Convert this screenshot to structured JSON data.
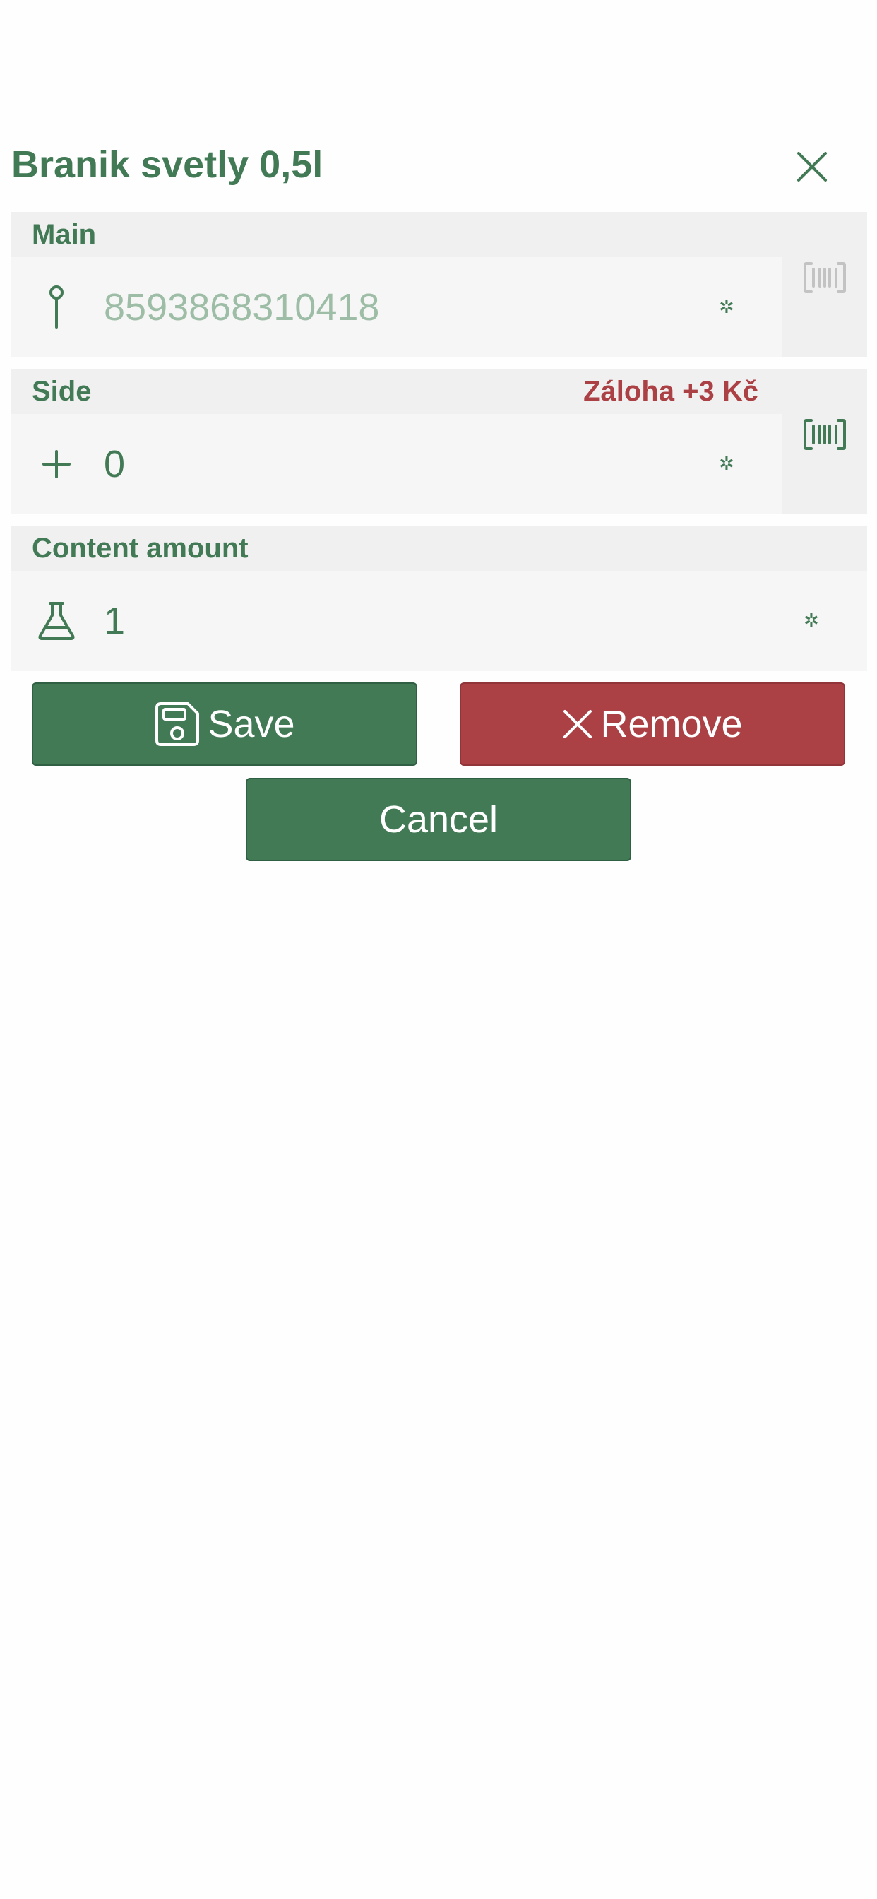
{
  "header": {
    "title": "Branik svetly 0,5l",
    "close_icon": "close-icon"
  },
  "main": {
    "label": "Main",
    "icon": "pin-icon",
    "value": "",
    "placeholder": "8593868310418",
    "required_mark": "✲",
    "scan_icon": "barcode-icon",
    "scan_enabled": false
  },
  "side": {
    "label": "Side",
    "deposit": "Záloha +3 Kč",
    "icon": "plus-icon",
    "value": "0",
    "required_mark": "✲",
    "scan_icon": "barcode-icon",
    "scan_enabled": true
  },
  "content": {
    "label": "Content amount",
    "icon": "flask-icon",
    "value": "1",
    "required_mark": "✲"
  },
  "actions": {
    "save_label": "Save",
    "save_icon": "floppy-disk-icon",
    "remove_label": "Remove",
    "remove_icon": "x-icon",
    "cancel_label": "Cancel"
  },
  "colors": {
    "primary": "#427a56",
    "danger": "#ab4045",
    "placeholder": "#9dbda6",
    "disabled_icon": "#c3c3c3",
    "section_bg": "#f0f0f0",
    "field_bg": "#f6f6f6"
  }
}
